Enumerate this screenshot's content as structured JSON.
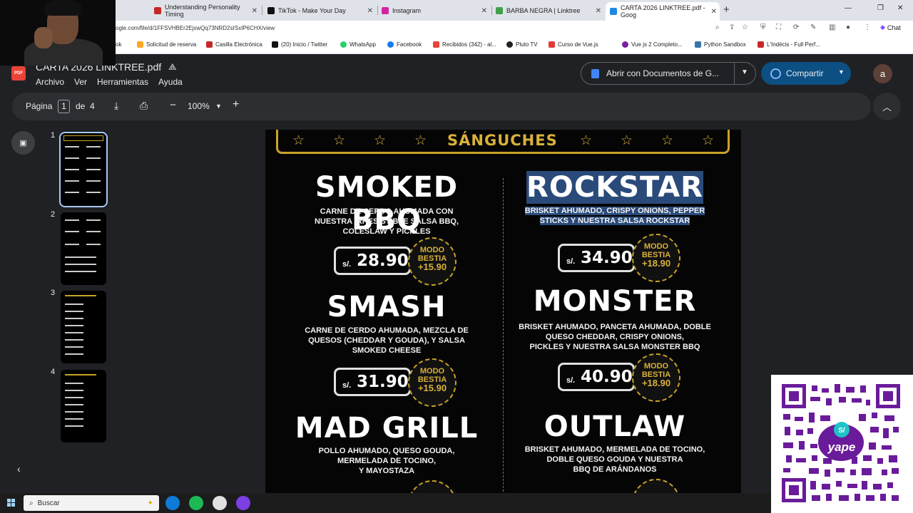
{
  "browser": {
    "tabs": [
      {
        "label": "Understanding Personality Timing",
        "color": "#c62828",
        "active": false
      },
      {
        "label": "TikTok - Make Your Day",
        "color": "#111111",
        "active": false
      },
      {
        "label": "Instagram",
        "color": "#d6249f",
        "active": false
      },
      {
        "label": "BARBA NEGRA | Linktree",
        "color": "#43a047",
        "active": false
      },
      {
        "label": "CARTA 2026 LINKTREE.pdf - Goog",
        "color": "#1e88e5",
        "active": true
      }
    ],
    "new_tab": "+",
    "url": "ogle.com/file/d/1FFSVHBEr2EjxwQq73NRD2sISxIP6CHX/view",
    "chat_label": "Chat",
    "bookmarks": [
      {
        "label": "ok",
        "color": "#111111"
      },
      {
        "label": "Solicitud de reserva",
        "color": "#f9a825"
      },
      {
        "label": "Casilla Electrónica",
        "color": "#c62828"
      },
      {
        "label": "(20) Inicio / Twitter",
        "color": "#111111"
      },
      {
        "label": "WhatsApp",
        "color": "#25d366"
      },
      {
        "label": "Facebook",
        "color": "#1877f2"
      },
      {
        "label": "Recibidos (342) - al...",
        "color": "#ea4335"
      },
      {
        "label": "Pluto TV",
        "color": "#222222"
      },
      {
        "label": "Curso de Vue.js",
        "color": "#e53935"
      },
      {
        "label": "Vue js 2 Completo...",
        "color": "#7b1fa2"
      },
      {
        "label": "Python Sandbox",
        "color": "#3776ab"
      },
      {
        "label": "L'Indécis - Full Perf...",
        "color": "#c62828"
      }
    ]
  },
  "drive": {
    "file_title": "CARTA 2026 LINKTREE.pdf",
    "file_badge": "PDF",
    "menu": [
      "Archivo",
      "Ver",
      "Herramientas",
      "Ayuda"
    ],
    "open_with_label": "Abrir con Documentos de G...",
    "share_label": "Compartir",
    "avatar_letter": "a"
  },
  "toolbar": {
    "page_label": "Página",
    "current_page": "1",
    "of_label": "de",
    "total_pages": "4",
    "zoom": "100%",
    "minus": "−",
    "plus": "+"
  },
  "thumbnails": [
    "1",
    "2",
    "3",
    "4"
  ],
  "menu_page": {
    "section_title": "SÁNGUCHES",
    "currency": "s/.",
    "bestia_label": "MODO\nBESTIA",
    "items": [
      {
        "name": "SMOKED BBQ",
        "description": "CARNE DE CERDO AHUMADA CON\nNUESTRA  IRRESISTIBLE SALSA  BBQ,\nCOLESLAW Y PICKLES",
        "price": "28.90",
        "bestia": "+15.90"
      },
      {
        "name": "ROCKSTAR",
        "description": "BRISKET AHUMADO, CRISPY ONIONS, PEPPER\nSTICKS Y NUESTRA SALSA ROCKSTAR",
        "price": "34.90",
        "bestia": "+18.90"
      },
      {
        "name": "SMASH",
        "description": "CARNE DE CERDO AHUMADA, MEZCLA DE\nQUESOS (CHEDDAR Y GOUDA), Y SALSA\nSMOKED CHEESE",
        "price": "31.90",
        "bestia": "+15.90"
      },
      {
        "name": "MONSTER",
        "description": "BRISKET AHUMADO, PANCETA AHUMADA, DOBLE\nQUESO CHEDDAR, CRISPY ONIONS,\nPICKLES Y NUESTRA SALSA MONSTER BBQ",
        "price": "40.90",
        "bestia": "+18.90"
      },
      {
        "name": "MAD GRILL",
        "description": "POLLO AHUMADO, QUESO GOUDA,\nMERMELADA DE TOCINO,\nY MAYOSTAZA",
        "price": "",
        "bestia": ""
      },
      {
        "name": "OUTLAW",
        "description": "BRISKET AHUMADO, MERMELADA DE TOCINO,\nDOBLE QUESO GOUDA Y NUESTRA\nBBQ DE ARÁNDANOS",
        "price": "",
        "bestia": ""
      }
    ]
  },
  "qr": {
    "label": "yape",
    "currency_badge": "S/"
  },
  "taskbar": {
    "search_placeholder": "Buscar"
  }
}
